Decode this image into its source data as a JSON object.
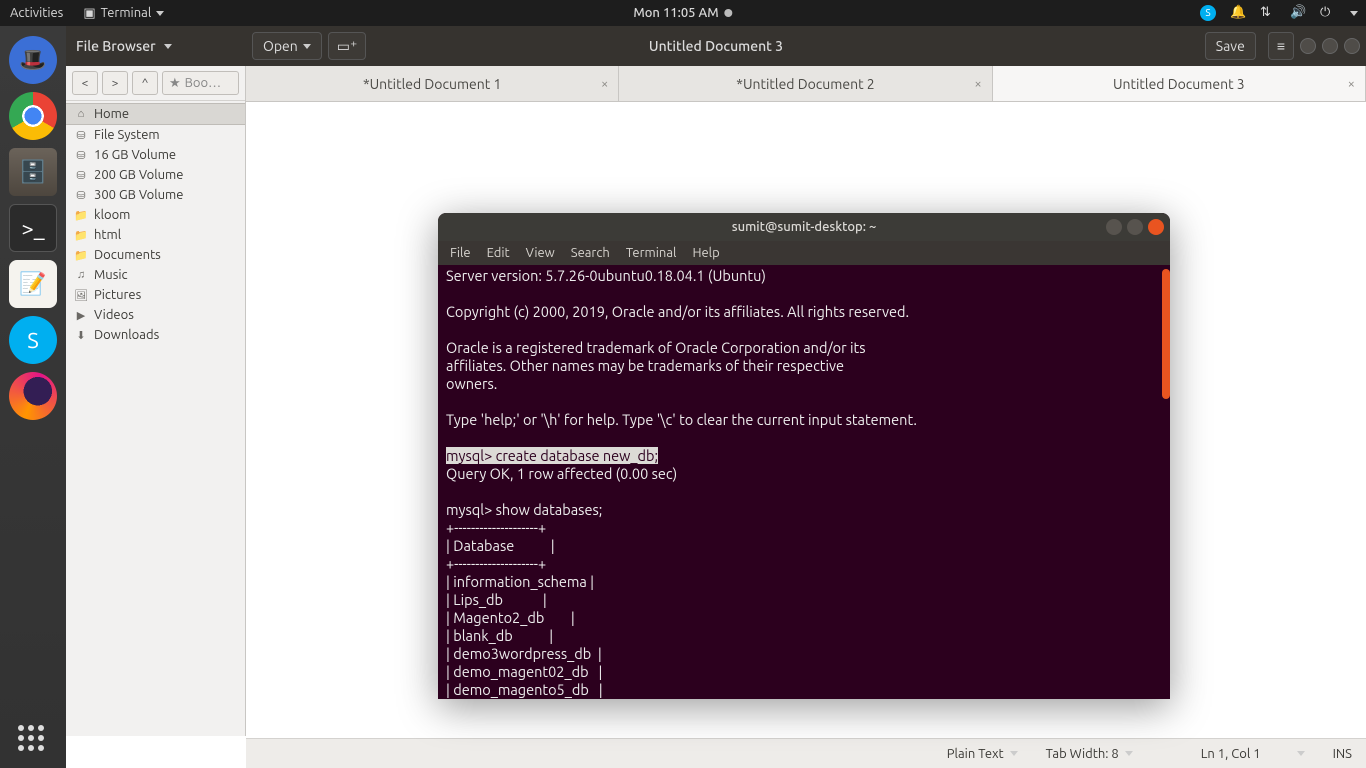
{
  "panel": {
    "activities": "Activities",
    "appmenu": "Terminal",
    "clock": "Mon 11:05 AM"
  },
  "gedit": {
    "filebrowser_label": "File Browser",
    "open": "Open",
    "title": "Untitled Document 3",
    "save": "Save",
    "tabs": [
      {
        "label": "*Untitled Document 1"
      },
      {
        "label": "*Untitled Document 2"
      },
      {
        "label": "Untitled Document 3"
      }
    ],
    "bookmark_placeholder": "Boo…"
  },
  "fb": {
    "items": [
      {
        "icon": "home",
        "label": "Home",
        "sel": true
      },
      {
        "icon": "disk",
        "label": "File System"
      },
      {
        "icon": "disk",
        "label": "16 GB Volume"
      },
      {
        "icon": "disk",
        "label": "200 GB Volume"
      },
      {
        "icon": "disk",
        "label": "300 GB Volume"
      },
      {
        "icon": "folder",
        "label": "kloom"
      },
      {
        "icon": "folder",
        "label": "html"
      },
      {
        "icon": "folder",
        "label": "Documents"
      },
      {
        "icon": "music",
        "label": "Music"
      },
      {
        "icon": "pic",
        "label": "Pictures"
      },
      {
        "icon": "video",
        "label": "Videos"
      },
      {
        "icon": "down",
        "label": "Downloads"
      }
    ]
  },
  "status": {
    "syntax": "Plain Text",
    "tabwidth": "Tab Width: 8",
    "pos": "Ln 1, Col 1",
    "ins": "INS"
  },
  "term": {
    "title": "sumit@sumit-desktop: ~",
    "menu": [
      "File",
      "Edit",
      "View",
      "Search",
      "Terminal",
      "Help"
    ],
    "l0": "Server version: 5.7.26-0ubuntu0.18.04.1 (Ubuntu)",
    "l1": "",
    "l2": "Copyright (c) 2000, 2019, Oracle and/or its affiliates. All rights reserved.",
    "l3": "",
    "l4": "Oracle is a registered trademark of Oracle Corporation and/or its",
    "l5": "affiliates. Other names may be trademarks of their respective",
    "l6": "owners.",
    "l7": "",
    "l8": "Type 'help;' or '\\h' for help. Type '\\c' to clear the current input statement.",
    "l9": "",
    "p1": "mysql> create database new_db;",
    "l10": "Query OK, 1 row affected (0.00 sec)",
    "l11": "",
    "l12": "mysql> show databases;",
    "l13": "+--------------------+",
    "l14": "| Database           |",
    "l15": "+--------------------+",
    "l16": "| information_schema |",
    "l17": "| Lips_db            |",
    "l18": "| Magento2_db        |",
    "l19": "| blank_db           |",
    "l20": "| demo3wordpress_db  |",
    "l21": "| demo_magent02_db   |",
    "l22": "| demo_magento5_db   |"
  }
}
